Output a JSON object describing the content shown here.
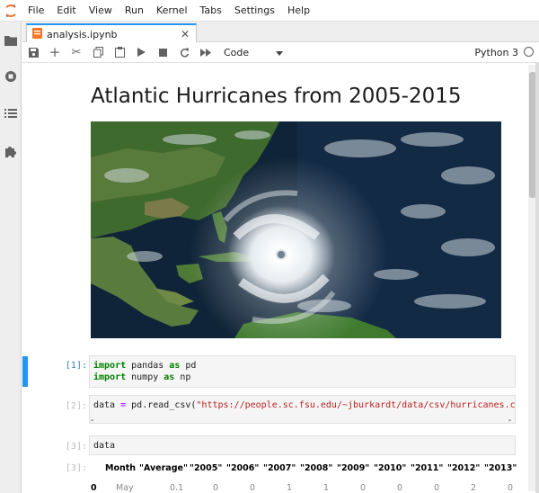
{
  "menu": [
    "File",
    "Edit",
    "View",
    "Run",
    "Kernel",
    "Tabs",
    "Settings",
    "Help"
  ],
  "tab": {
    "label": "analysis.ipynb"
  },
  "toolbar": {
    "cell_type": "Code",
    "kernel": "Python 3"
  },
  "notebook": {
    "title": "Atlantic Hurricanes from 2005-2015",
    "cells": [
      {
        "prompt": "[1]:",
        "line1_kw": "import",
        "line1_rest": " pandas ",
        "line1_kw2": "as",
        "line1_end": " pd",
        "line2_kw": "import",
        "line2_rest": " numpy ",
        "line2_kw2": "as",
        "line2_end": " np"
      },
      {
        "prompt": "[2]:",
        "var": "data",
        "eq": " = ",
        "call": "pd.read_csv(",
        "url": "\"https://people.sc.fsu.edu/~jburkardt/data/csv/hurricanes.csv\"",
        "close": ")"
      },
      {
        "prompt": "[3]:",
        "code": "data"
      }
    ],
    "output": {
      "prompt": "[3]:",
      "columns": [
        "Month",
        "\"Average\"",
        "\"2005\"",
        "\"2006\"",
        "\"2007\"",
        "\"2008\"",
        "\"2009\"",
        "\"2010\"",
        "\"2011\"",
        "\"2012\"",
        "\"2013\""
      ],
      "first_row": [
        "0",
        "May",
        "0.1",
        "0",
        "0",
        "1",
        "1",
        "0",
        "0",
        "0",
        "2",
        "0"
      ]
    }
  }
}
